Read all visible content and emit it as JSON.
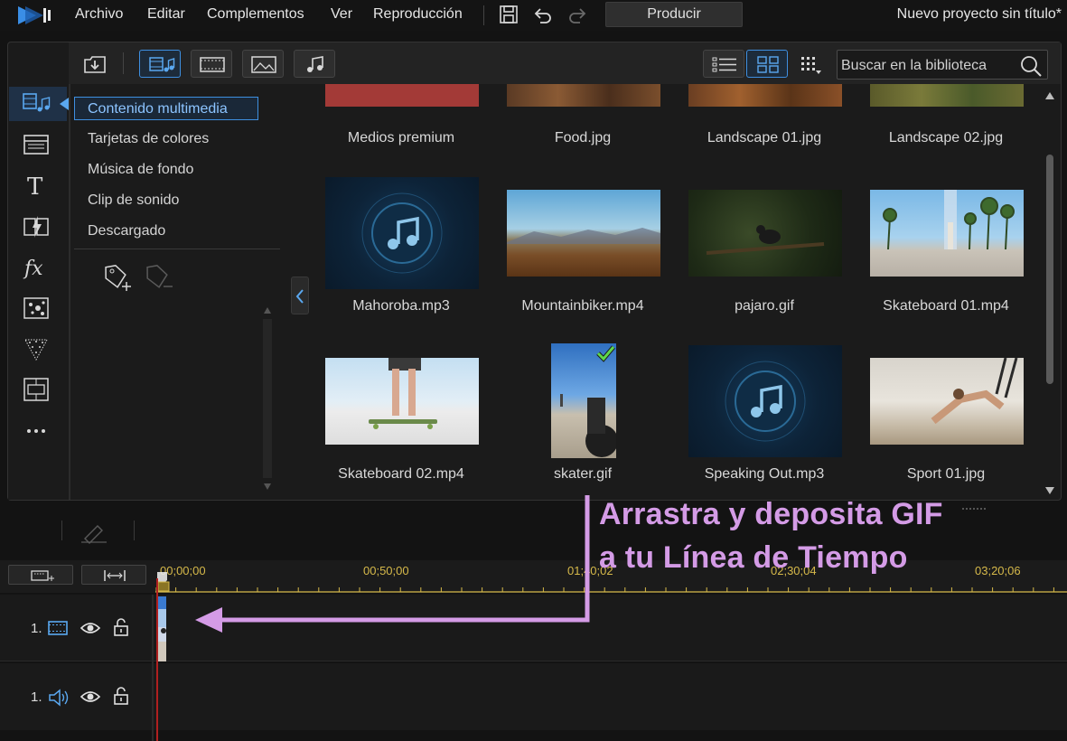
{
  "menu": {
    "items": [
      "Archivo",
      "Editar",
      "Complementos",
      "Ver",
      "Reproducción"
    ],
    "produce_label": "Producir",
    "project_title": "Nuevo proyecto sin título*"
  },
  "library": {
    "search_placeholder": "Buscar en la biblioteca",
    "tree": [
      "Contenido multimedia",
      "Tarjetas de colores",
      "Música de fondo",
      "Clip de sonido",
      "Descargado"
    ],
    "selected_tree_item": "Contenido multimedia",
    "items": [
      {
        "name": "Medios premium",
        "kind": "banner"
      },
      {
        "name": "Food.jpg",
        "kind": "image"
      },
      {
        "name": "Landscape 01.jpg",
        "kind": "image"
      },
      {
        "name": "Landscape 02.jpg",
        "kind": "image"
      },
      {
        "name": "Mahoroba.mp3",
        "kind": "audio"
      },
      {
        "name": "Mountainbiker.mp4",
        "kind": "video"
      },
      {
        "name": "pajaro.gif",
        "kind": "gif"
      },
      {
        "name": "Skateboard 01.mp4",
        "kind": "video"
      },
      {
        "name": "Skateboard 02.mp4",
        "kind": "video"
      },
      {
        "name": "skater.gif",
        "kind": "gif",
        "in_use": true
      },
      {
        "name": "Speaking Out.mp3",
        "kind": "audio"
      },
      {
        "name": "Sport 01.jpg",
        "kind": "image"
      }
    ]
  },
  "timeline": {
    "ticks": [
      "00;00;00",
      "00;50;00",
      "01;40;02",
      "02;30;04",
      "03;20;06"
    ],
    "tracks": [
      {
        "number": "1.",
        "type": "video"
      },
      {
        "number": "1.",
        "type": "audio"
      }
    ]
  },
  "annotation": {
    "line1": "Arrastra y deposita GIF",
    "line2": "a tu Línea de Tiempo",
    "color": "#d49be6"
  },
  "colors": {
    "accent": "#3e8fe0",
    "timecode": "#d6b94a",
    "playhead": "#b02020"
  }
}
